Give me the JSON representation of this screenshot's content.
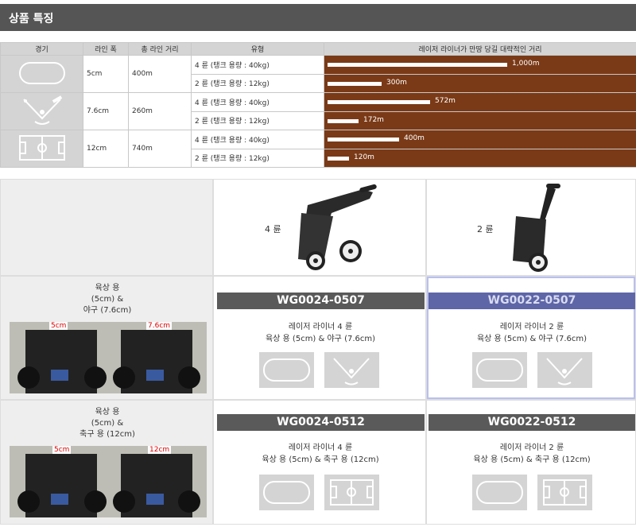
{
  "header": {
    "title": "상품 특징"
  },
  "spec_table": {
    "headers": [
      "경기",
      "라인 폭",
      "총 라인 거리",
      "유형",
      "레이저 라이너가 만땅 당길 대략적인 거리"
    ],
    "groups": [
      {
        "icon": "track-icon",
        "width": "5cm",
        "distance": "400m",
        "rows": [
          {
            "type": "4 륜 (탱크 용량 : 40kg)",
            "range": "1,000m",
            "ratio": 1.0
          },
          {
            "type": "2 륜 (탱크 용량 : 12kg)",
            "range": "300m",
            "ratio": 0.3
          }
        ]
      },
      {
        "icon": "baseball-field-icon",
        "width": "7.6cm",
        "distance": "260m",
        "rows": [
          {
            "type": "4 륜 (탱크 용량 : 40kg)",
            "range": "572m",
            "ratio": 0.572
          },
          {
            "type": "2 륜 (탱크 용량 : 12kg)",
            "range": "172m",
            "ratio": 0.172
          }
        ]
      },
      {
        "icon": "soccer-field-icon",
        "width": "12cm",
        "distance": "740m",
        "rows": [
          {
            "type": "4 륜 (탱크 용량 : 40kg)",
            "range": "400m",
            "ratio": 0.4
          },
          {
            "type": "2 륜 (탱크 용량 : 12kg)",
            "range": "120m",
            "ratio": 0.12
          }
        ]
      }
    ]
  },
  "products": {
    "col_headers": [
      "4 륜",
      "2 륜"
    ],
    "row1": {
      "category": [
        "육상 용",
        "(5cm) &",
        "야구 (7.6cm)"
      ],
      "photo_labels": [
        "5cm",
        "7.6cm"
      ],
      "items": [
        {
          "model": "WG0024-0507",
          "desc1": "레이저 라이너 4 륜",
          "desc2": "육상 용 (5cm) & 야구 (7.6cm)"
        },
        {
          "model": "WG0022-0507",
          "desc1": "레이저 라이너 2 륜",
          "desc2": "육상 용 (5cm) & 야구 (7.6cm)"
        }
      ]
    },
    "row2": {
      "category": [
        "육상 용",
        "(5cm) &",
        "축구 용 (12cm)"
      ],
      "photo_labels": [
        "5cm",
        "12cm"
      ],
      "items": [
        {
          "model": "WG0024-0512",
          "desc1": "레이저 라이너 4 륜",
          "desc2": "육상 용 (5cm) & 축구 용 (12cm)"
        },
        {
          "model": "WG0022-0512",
          "desc1": "레이저 라이너 2 륜",
          "desc2": "육상 용 (5cm) & 축구 용 (12cm)"
        }
      ]
    }
  },
  "colors": {
    "header_bg": "#555555",
    "bar_bg": "#7a3a17",
    "model_bar": "#5a5a5a",
    "selected": "#5e66a8"
  }
}
